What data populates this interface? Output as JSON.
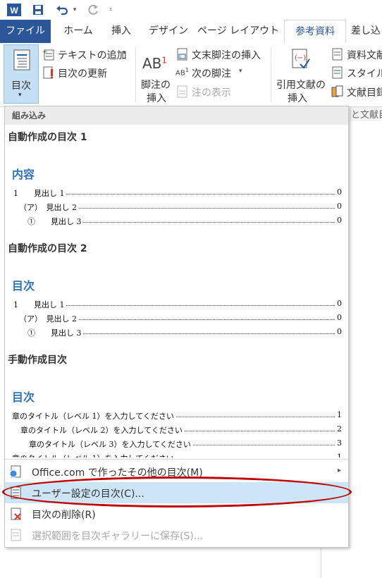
{
  "qat": {
    "word_icon": "word-logo",
    "save": "save-icon",
    "undo": "undo-icon",
    "redo": "redo-icon",
    "customize": "customize-qat-icon"
  },
  "tabs": [
    "ファイル",
    "ホーム",
    "挿入",
    "デザイン",
    "ページ レイアウト",
    "参考資料",
    "差し込"
  ],
  "active_tab": "参考資料",
  "ribbon": {
    "toc_button": "目次",
    "add_text": "テキストの追加",
    "update_toc": "目次の更新",
    "insert_footnote_1": "脚注の",
    "insert_footnote_2": "挿入",
    "ab_label": "AB",
    "ab_sup": "1",
    "insert_endnote": "文末脚注の挿入",
    "next_footnote": "次の脚注",
    "show_notes": "注の表示",
    "citation_1": "引用文献の",
    "citation_2": "挿入",
    "manage_sources": "資料文献",
    "style": "スタイル:",
    "bibliography": "文献目録",
    "citations_group": "と文献目"
  },
  "menu": {
    "gallery_header": "組み込み",
    "sections": [
      {
        "title": "自動作成の目次 1",
        "heading": "内容",
        "rows": [
          {
            "label": "1　　見出し 1",
            "page": "0"
          },
          {
            "label": "（ア）　見出し 2",
            "page": "0"
          },
          {
            "label": "①　　見出し 3",
            "page": "0"
          }
        ]
      },
      {
        "title": "自動作成の目次 2",
        "heading": "目次",
        "rows": [
          {
            "label": "1　　見出し 1",
            "page": "0"
          },
          {
            "label": "（ア）　見出し 2",
            "page": "0"
          },
          {
            "label": "①　　見出し 3",
            "page": "0"
          }
        ]
      },
      {
        "title": "手動作成目次",
        "heading": "目次",
        "rows": [
          {
            "label": "章のタイトル（レベル 1）を入力してください",
            "page": "1"
          },
          {
            "label": "章のタイトル（レベル 2）を入力してください",
            "page": "2"
          },
          {
            "label": "章のタイトル（レベル 3）を入力してください",
            "page": "3"
          }
        ]
      }
    ],
    "items": [
      {
        "label": "Office.com で作ったその他の目次(M)",
        "enabled": true,
        "submenu": true
      },
      {
        "label": "ユーザー設定の目次(C)...",
        "enabled": true,
        "highlighted": true
      },
      {
        "label": "目次の削除(R)",
        "enabled": true
      },
      {
        "label": "選択範囲を目次ギャラリーに保存(S)...",
        "enabled": false
      }
    ]
  },
  "colors": {
    "file_tab": "#2b579a",
    "heading": "#2e74b5",
    "highlight": "#cde6f7",
    "annotation": "#c00000"
  }
}
